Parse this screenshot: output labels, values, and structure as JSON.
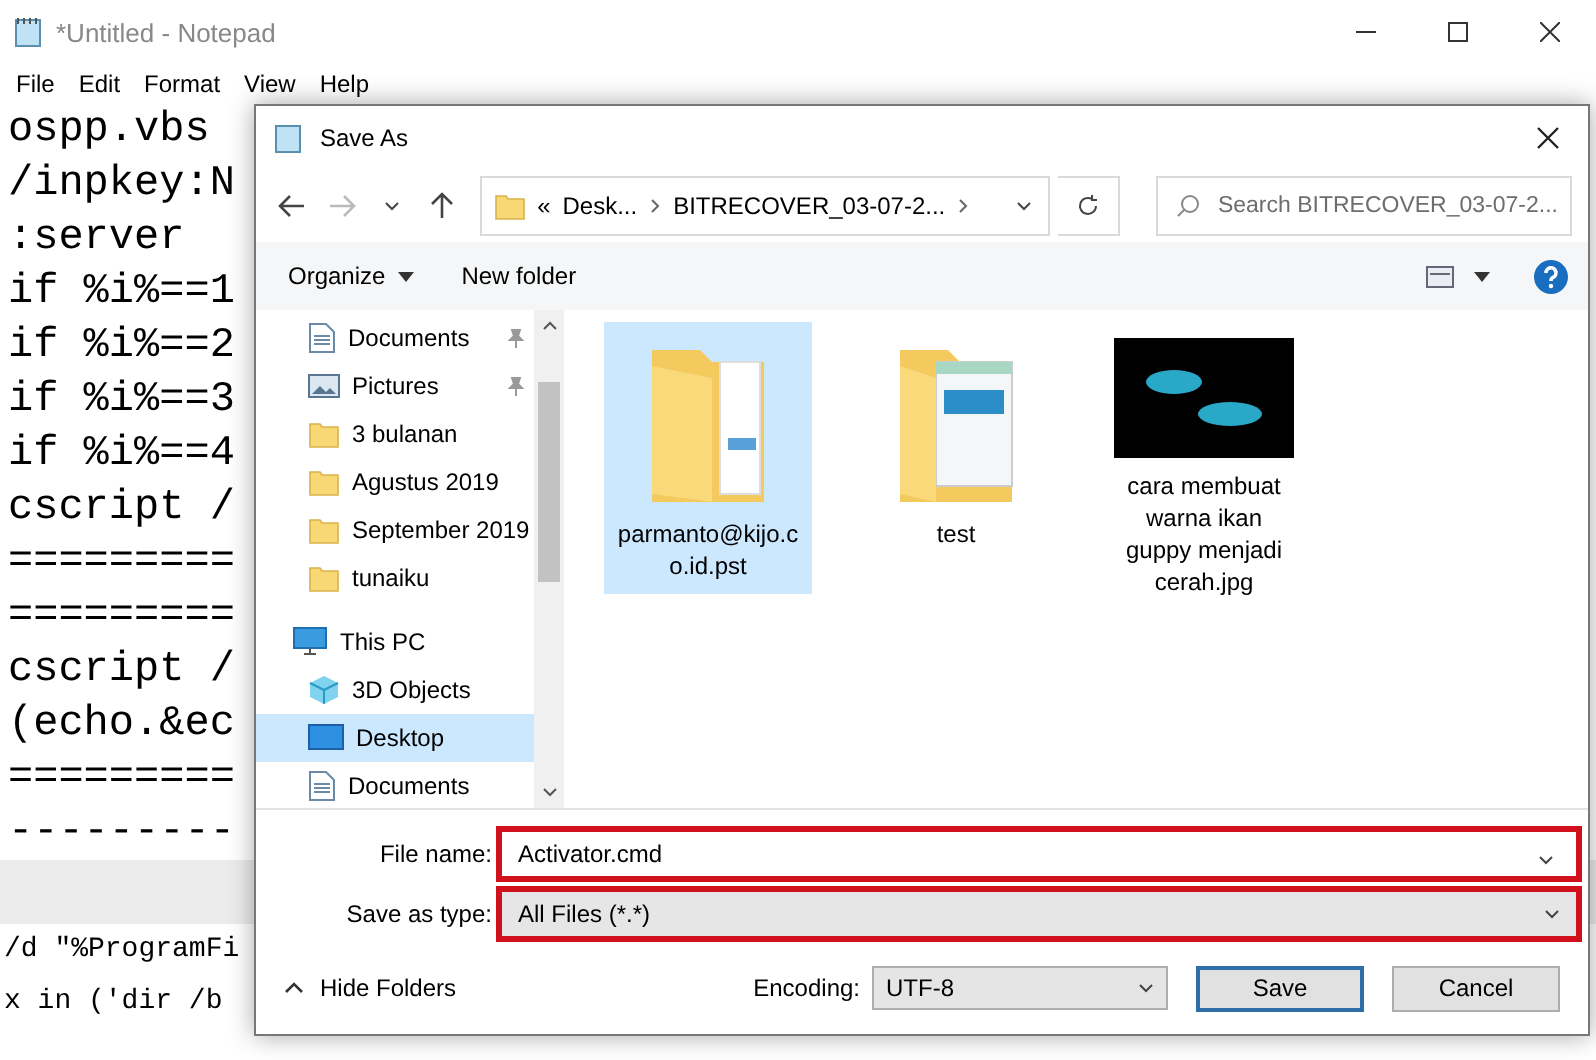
{
  "notepad": {
    "title": "*Untitled - Notepad",
    "menu": [
      "File",
      "Edit",
      "Format",
      "View",
      "Help"
    ],
    "lines": [
      "ospp.vbs",
      "/inpkey:N",
      ":server",
      "if %i%==1",
      "if %i%==2",
      "if %i%==3",
      "if %i%==4",
      "cscript /",
      "=========",
      "=========",
      "cscript /",
      "(echo.&ec",
      "=========",
      "---------"
    ],
    "lower_lines": [
      "/d \"%ProgramFi",
      "x in ('dir /b"
    ]
  },
  "dialog": {
    "title": "Save As",
    "address": {
      "overflow_mark": "«",
      "crumbs": [
        "Desk...",
        "BITRECOVER_03-07-2..."
      ]
    },
    "search": {
      "placeholder": "Search BITRECOVER_03-07-2..."
    },
    "toolbar": {
      "organize": "Organize",
      "new_folder": "New folder"
    },
    "nav_pane": {
      "items": [
        {
          "label": "Documents",
          "kind": "documents",
          "pinned": true,
          "selected": false
        },
        {
          "label": "Pictures",
          "kind": "pictures",
          "pinned": true,
          "selected": false
        },
        {
          "label": "3 bulanan",
          "kind": "folder",
          "pinned": false,
          "selected": false
        },
        {
          "label": "Agustus 2019",
          "kind": "folder",
          "pinned": false,
          "selected": false
        },
        {
          "label": "September 2019",
          "kind": "folder",
          "pinned": false,
          "selected": false
        },
        {
          "label": "tunaiku",
          "kind": "folder",
          "pinned": false,
          "selected": false
        },
        {
          "label": "This PC",
          "kind": "pc",
          "pinned": false,
          "selected": false,
          "children": [
            {
              "label": "3D Objects",
              "kind": "objects",
              "pinned": false,
              "selected": false
            },
            {
              "label": "Desktop",
              "kind": "desktop",
              "pinned": false,
              "selected": true
            },
            {
              "label": "Documents",
              "kind": "documents",
              "pinned": false,
              "selected": false
            }
          ]
        }
      ]
    },
    "files": [
      {
        "name": "parmanto@kijo.co.id.pst",
        "kind": "folder",
        "selected": true
      },
      {
        "name": "test",
        "kind": "folder-doc",
        "selected": false
      },
      {
        "name": "cara membuat warna ikan guppy menjadi cerah.jpg",
        "kind": "image",
        "selected": false
      }
    ],
    "file_name": {
      "label": "File name:",
      "value": "Activator.cmd",
      "highlighted": true
    },
    "save_as_type": {
      "label": "Save as type:",
      "value": "All Files  (*.*)",
      "highlighted": true
    },
    "hide_folders": "Hide Folders",
    "encoding": {
      "label": "Encoding:",
      "value": "UTF-8"
    },
    "buttons": [
      {
        "label": "Save",
        "default": true
      },
      {
        "label": "Cancel",
        "default": false
      }
    ]
  }
}
